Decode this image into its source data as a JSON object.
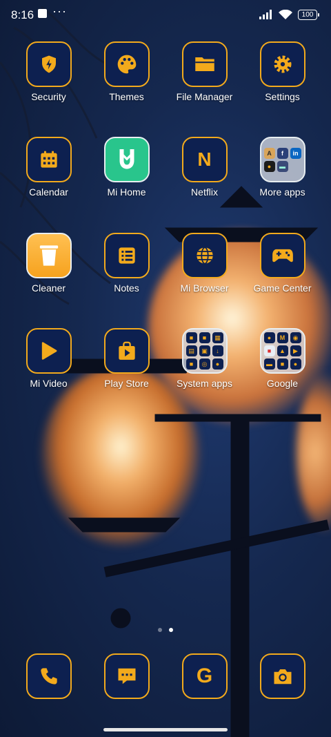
{
  "status_bar": {
    "time": "8:16",
    "more_indicator": "···",
    "battery": "100",
    "icons": [
      "notification-square-icon",
      "signal-icon",
      "wifi-icon",
      "battery-icon"
    ]
  },
  "colors": {
    "accent": "#f3aa1c",
    "icon_bg": "#0d2050",
    "mihome_green": "#29c58c",
    "cleaner_yellow": "#f8ad28"
  },
  "apps": [
    {
      "label": "Security",
      "icon": "shield-bolt-icon"
    },
    {
      "label": "Themes",
      "icon": "palette-icon"
    },
    {
      "label": "File Manager",
      "icon": "folder-icon"
    },
    {
      "label": "Settings",
      "icon": "gear-icon"
    },
    {
      "label": "Calendar",
      "icon": "calendar-icon"
    },
    {
      "label": "Mi Home",
      "icon": "mihome-logo-icon"
    },
    {
      "label": "Netflix",
      "icon": "netflix-n-icon",
      "glyph": "N"
    },
    {
      "label": "More apps",
      "icon": "folder-icon"
    },
    {
      "label": "Cleaner",
      "icon": "trash-icon"
    },
    {
      "label": "Notes",
      "icon": "list-icon"
    },
    {
      "label": "Mi Browser",
      "icon": "globe-icon"
    },
    {
      "label": "Game Center",
      "icon": "gamepad-icon"
    },
    {
      "label": "Mi Video",
      "icon": "play-icon"
    },
    {
      "label": "Play Store",
      "icon": "play-store-bag-icon"
    },
    {
      "label": "System apps",
      "icon": "folder-icon"
    },
    {
      "label": "Google",
      "icon": "folder-icon"
    }
  ],
  "folders": {
    "more_apps": [
      "A",
      "f",
      "in",
      "●",
      "▬"
    ],
    "system_apps": [
      "■",
      "■",
      "▦",
      "▤",
      "▣",
      "↓",
      "■",
      "◎",
      "●"
    ],
    "google": [
      "●",
      "M",
      "◉",
      "■",
      "▲",
      "▶",
      "▬",
      "■",
      "●"
    ]
  },
  "page_indicator": {
    "pages": 2,
    "current": 2
  },
  "dock": [
    {
      "name": "phone",
      "icon": "phone-icon"
    },
    {
      "name": "messages",
      "icon": "message-icon"
    },
    {
      "name": "google",
      "icon": "google-g-icon",
      "glyph": "G"
    },
    {
      "name": "camera",
      "icon": "camera-icon"
    }
  ]
}
